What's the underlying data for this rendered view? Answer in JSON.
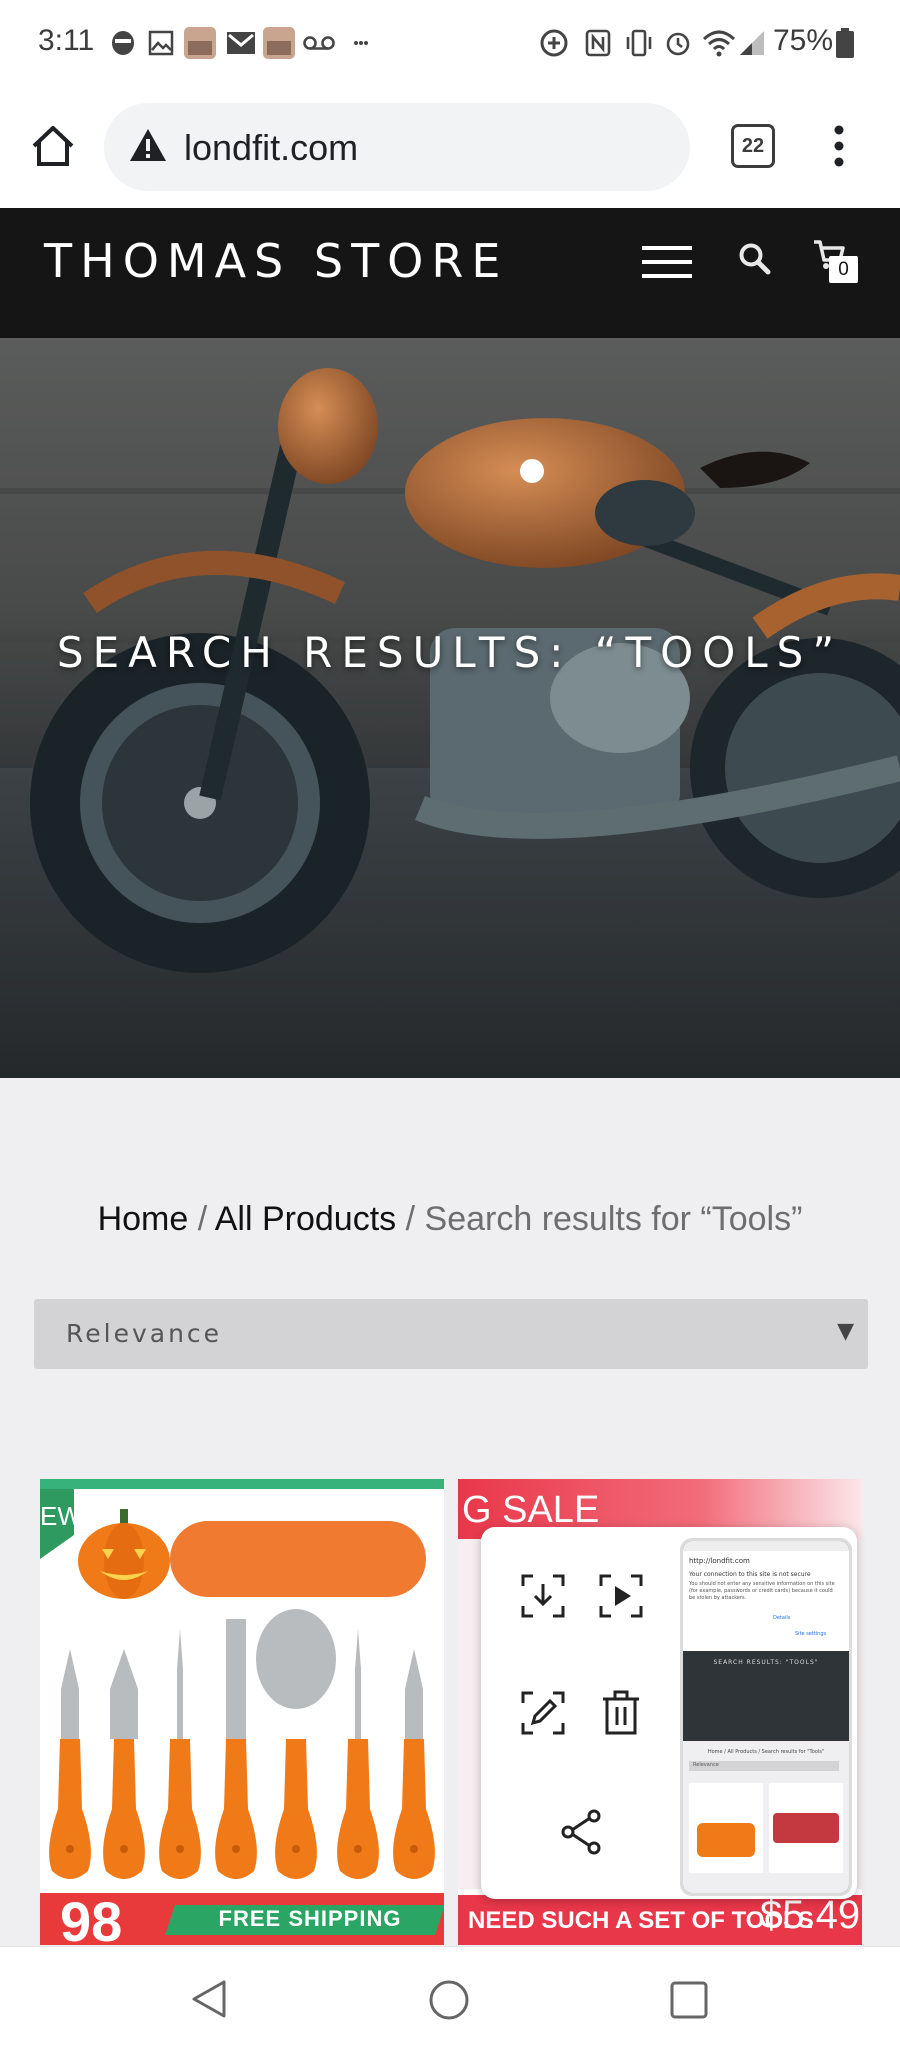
{
  "status_bar": {
    "time": "3:11",
    "battery_percent": "75%",
    "left_icons": [
      "face-icon",
      "image-icon",
      "photo-thumb-icon",
      "gmail-icon",
      "photo-thumb-icon",
      "voicemail-icon",
      "more-dots-icon"
    ],
    "right_icons": [
      "data-saver-icon",
      "nfc-icon",
      "vibrate-icon",
      "alarm-icon",
      "wifi-icon",
      "signal-icon",
      "battery-icon"
    ]
  },
  "browser": {
    "url": "londfit.com",
    "tab_count": "22",
    "security_icon": "warning-triangle-icon"
  },
  "site": {
    "title": "THOMAS STORE",
    "cart_count": "0",
    "hero_title": "SEARCH RESULTS: “TOOLS”"
  },
  "breadcrumb": {
    "home": "Home",
    "separator": "/",
    "all_products": "All Products",
    "current": "Search results for “Tools”"
  },
  "sort": {
    "selected": "Relevance"
  },
  "products": [
    {
      "badge": "EW",
      "bottom_banner": "FREE SHIPPING",
      "price_fragment": "98"
    },
    {
      "badge": "G SALE",
      "bottom_banner": "NEED SUCH A SET OF TOOLS",
      "price_fragment": "$5.49"
    }
  ],
  "screenshot_popup": {
    "actions": [
      "download-icon",
      "scroll-capture-icon",
      "edit-icon",
      "delete-icon",
      "share-icon"
    ],
    "thumb_text": {
      "url": "http://londfit.com",
      "warning_title": "Your connection to this site is not secure",
      "warning_body": "You should not enter any sensitive information on this site (for example, passwords or credit cards) because it could be stolen by attackers.",
      "details_link": "Details",
      "site_settings": "Site settings",
      "hero": "SEARCH RESULTS: \"TOOLS\"",
      "breadcrumb": "Home / All Products / Search results for \"Tools\"",
      "sort": "Relevance"
    }
  },
  "colors": {
    "header_bg": "#151515",
    "page_bg": "#efeff1",
    "select_bg": "#d3d3d6",
    "orange": "#f07a18"
  }
}
